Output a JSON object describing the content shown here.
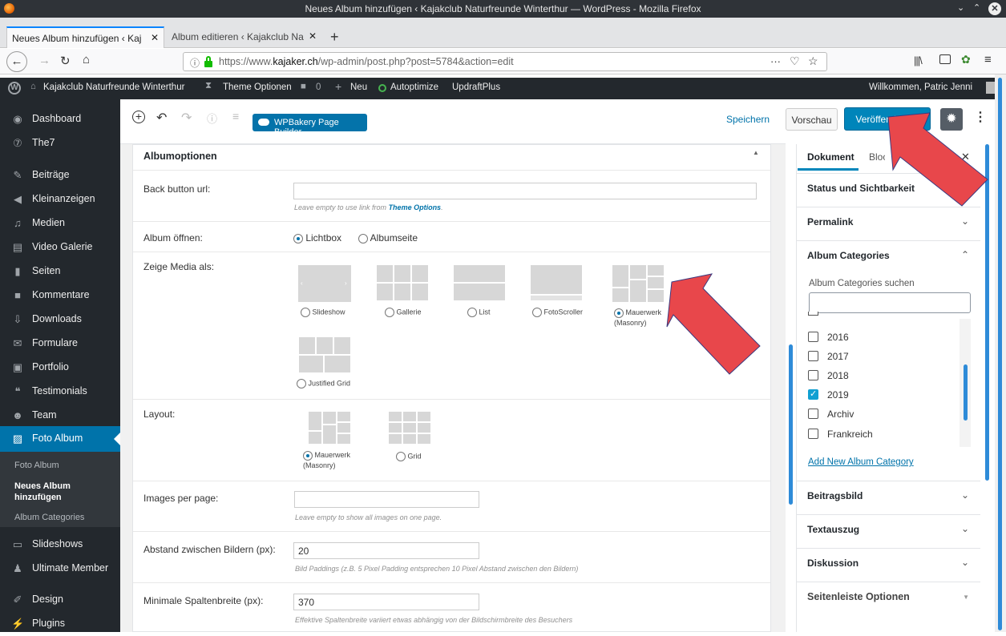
{
  "window": {
    "title": "Neues Album hinzufügen ‹ Kajakclub Naturfreunde Winterthur — WordPress - Mozilla Firefox"
  },
  "tabs": [
    {
      "label": "Neues Album hinzufügen ‹ Kaj"
    },
    {
      "label": "Album editieren ‹ Kajakclub Na"
    }
  ],
  "url": {
    "prefix": "https://www.",
    "domain": "kajaker.ch",
    "path": "/wp-admin/post.php?post=5784&action=edit"
  },
  "adminbar": {
    "site": "Kajakclub Naturfreunde Winterthur",
    "theme_options": "Theme Optionen",
    "comments": "0",
    "new": "Neu",
    "autoptimize": "Autoptimize",
    "updraft": "UpdraftPlus",
    "welcome": "Willkommen, Patric Jenni"
  },
  "menu": [
    {
      "label": "Dashboard",
      "icon": "dashboard-icon"
    },
    {
      "label": "The7",
      "icon": "the7-icon"
    },
    {
      "label": "Beiträge",
      "icon": "pin-icon"
    },
    {
      "label": "Kleinanzeigen",
      "icon": "megaphone-icon"
    },
    {
      "label": "Medien",
      "icon": "media-icon"
    },
    {
      "label": "Video Galerie",
      "icon": "video-icon"
    },
    {
      "label": "Seiten",
      "icon": "page-icon"
    },
    {
      "label": "Kommentare",
      "icon": "comment-icon"
    },
    {
      "label": "Downloads",
      "icon": "download-icon"
    },
    {
      "label": "Formulare",
      "icon": "mail-icon"
    },
    {
      "label": "Portfolio",
      "icon": "portfolio-icon"
    },
    {
      "label": "Testimonials",
      "icon": "quote-icon"
    },
    {
      "label": "Team",
      "icon": "team-icon"
    },
    {
      "label": "Foto Album",
      "icon": "album-icon"
    }
  ],
  "submenu": [
    "Foto Album",
    "Neues Album hinzufügen",
    "Album Categories"
  ],
  "menu2": [
    {
      "label": "Slideshows",
      "icon": "slideshow-icon"
    },
    {
      "label": "Ultimate Member",
      "icon": "user-icon"
    },
    {
      "label": "Design",
      "icon": "brush-icon"
    },
    {
      "label": "Plugins",
      "icon": "plug-icon"
    }
  ],
  "toolbar": {
    "wpbakery": "WPBakery Page Builder",
    "save": "Speichern",
    "preview": "Vorschau",
    "publish": "Veröffentlichen"
  },
  "albumoptions": {
    "title": "Albumoptionen",
    "back_url_label": "Back button url:",
    "back_url_value": "",
    "back_url_hint_pre": "Leave empty to use link from ",
    "back_url_hint_link": "Theme Options",
    "back_url_hint_post": ".",
    "open_label": "Album öffnen:",
    "open_options": [
      "Lichtbox",
      "Albumseite"
    ],
    "media_label": "Zeige Media als:",
    "media_options": [
      "Slideshow",
      "Gallerie",
      "List",
      "FotoScroller",
      "Mauerwerk (Masonry)",
      "Justified Grid"
    ],
    "media_selected": "Mauerwerk (Masonry)",
    "layout_label": "Layout:",
    "layout_options": [
      "Mauerwerk (Masonry)",
      "Grid"
    ],
    "images_label": "Images per page:",
    "images_value": "",
    "images_hint": "Leave empty to show all images on one page.",
    "gap_label": "Abstand zwischen Bildern (px):",
    "gap_value": "20",
    "gap_hint": "Bild Paddings (z.B. 5 Pixel Padding entsprechen 10 Pixel Abstand zwischen den Bildern)",
    "col_label": "Minimale Spaltenbreite (px):",
    "col_value": "370",
    "col_hint": "Effektive Spaltenbreite variiert etwas abhängig von der Bildschirmbreite des Besuchers"
  },
  "settings": {
    "tab_document": "Dokument",
    "tab_block": "Block",
    "status": "Status und Sichtbarkeit",
    "permalink": "Permalink",
    "album_categories": "Album Categories",
    "search_label": "Album Categories suchen",
    "categories": [
      {
        "label": "2016",
        "checked": false
      },
      {
        "label": "2017",
        "checked": false
      },
      {
        "label": "2018",
        "checked": false
      },
      {
        "label": "2019",
        "checked": true
      },
      {
        "label": "Archiv",
        "checked": false
      },
      {
        "label": "Frankreich",
        "checked": false
      }
    ],
    "add_new": "Add New Album Category",
    "featured": "Beitragsbild",
    "excerpt": "Textauszug",
    "discussion": "Diskussion",
    "sidebar_options": "Seitenleiste Optionen"
  },
  "colors": {
    "accent": "#0085ba",
    "menu_active": "#0073aa",
    "arrow": "#e8474b"
  }
}
